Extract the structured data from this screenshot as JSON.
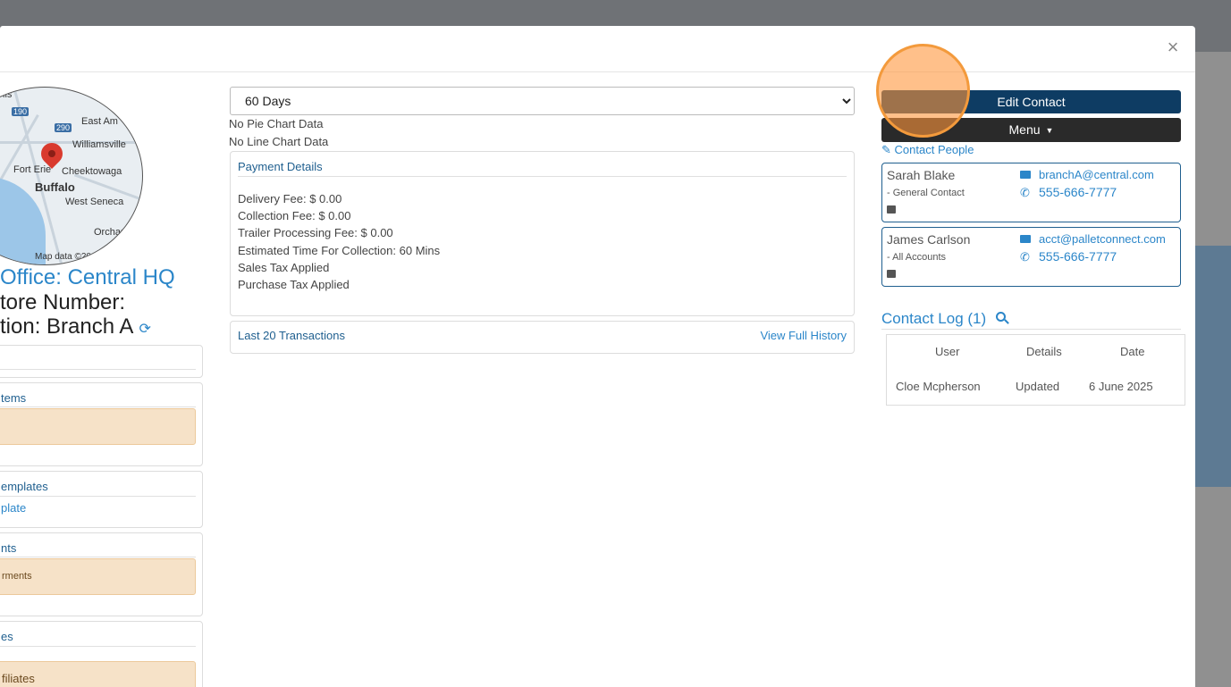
{
  "map": {
    "attribution": "Map data ©20",
    "labels": [
      "lls",
      "East Am",
      "Williamsville",
      "Fort Erie",
      "Cheektowaga",
      "Buffalo",
      "West Seneca",
      "Orchard Pa",
      "190",
      "290"
    ]
  },
  "location": {
    "office": "Office: Central HQ",
    "store": "tore Number:",
    "location": "tion: Branch A"
  },
  "left_cards": [
    {
      "title": "",
      "note": "",
      "link": ""
    },
    {
      "title": "tems",
      "note": "",
      "link": ""
    },
    {
      "title": "emplates",
      "note": "",
      "link": "plate"
    },
    {
      "title": "nts",
      "note": "rments",
      "link": ""
    },
    {
      "title": "es",
      "note": "filiates",
      "link": ""
    }
  ],
  "range": {
    "selected": "60 Days",
    "options": [
      "60 Days"
    ]
  },
  "charts": {
    "pie": "No Pie Chart Data",
    "line": "No Line Chart Data"
  },
  "payment": {
    "title": "Payment Details",
    "lines": [
      "Delivery Fee: $ 0.00",
      "Collection Fee: $ 0.00",
      "Trailer Processing Fee: $ 0.00",
      "Estimated Time For Collection: 60 Mins",
      "Sales Tax Applied",
      "Purchase Tax Applied"
    ]
  },
  "transactions": {
    "title": "Last 20 Transactions",
    "link": "View Full History"
  },
  "actions": {
    "edit": "Edit Contact",
    "menu": "Menu"
  },
  "contact_people": {
    "label": "Contact People",
    "people": [
      {
        "name": "Sarah Blake",
        "role": "- General Contact",
        "email": "branchA@central.com",
        "phone": "555-666-7777"
      },
      {
        "name": "James Carlson",
        "role": "- All Accounts",
        "email": "acct@palletconnect.com",
        "phone": "555-666-7777"
      }
    ]
  },
  "contact_log": {
    "title": "Contact Log (1)",
    "headers": [
      "User",
      "Details",
      "Date"
    ],
    "rows": [
      [
        "Cloe Mcpherson",
        "Updated",
        "6 June 2025"
      ]
    ]
  },
  "colors": {
    "accent": "#2b86c9",
    "primary_button": "#0e3c63",
    "menu_button": "#2a2a2a",
    "warning_bg": "#f6e2c8",
    "click_indicator": "#f39a3c"
  }
}
